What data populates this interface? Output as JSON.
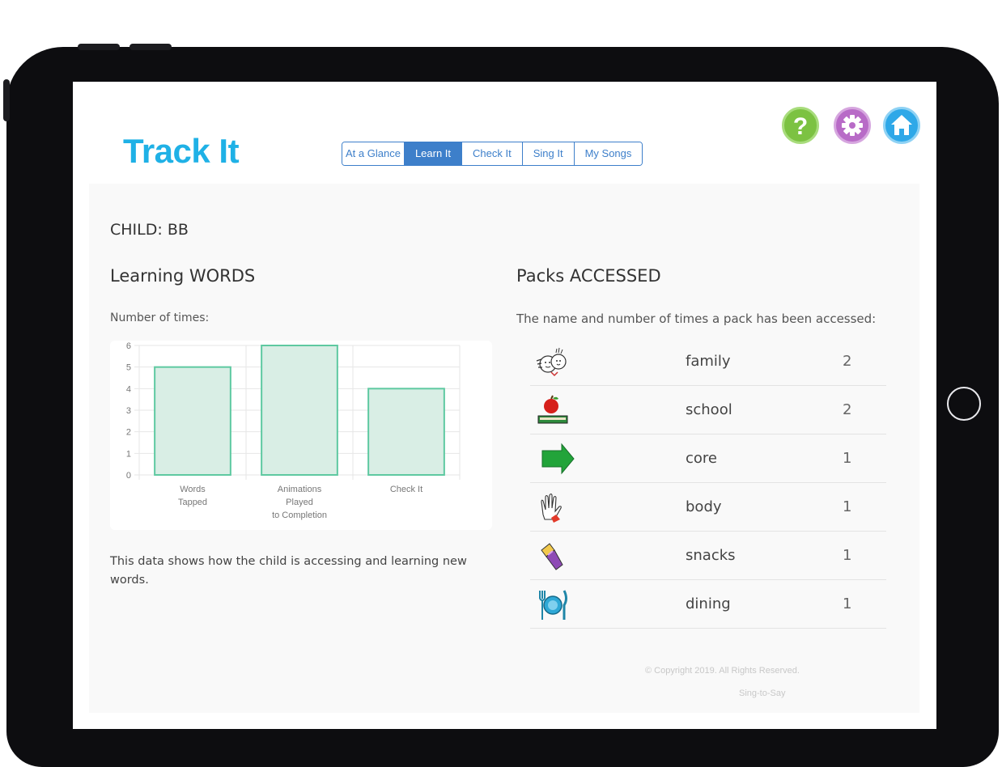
{
  "app": {
    "title": "Track It"
  },
  "tabs": [
    {
      "label": "At a Glance",
      "active": false
    },
    {
      "label": "Learn It",
      "active": true
    },
    {
      "label": "Check It",
      "active": false
    },
    {
      "label": "Sing It",
      "active": false
    },
    {
      "label": "My Songs",
      "active": false
    }
  ],
  "header_icons": [
    {
      "name": "help-icon",
      "color": "#7cc242"
    },
    {
      "name": "settings-icon",
      "color": "#b86bc7"
    },
    {
      "name": "home-icon",
      "color": "#2ea8e8"
    }
  ],
  "child": {
    "label": "CHILD: ",
    "name": "BB"
  },
  "learning": {
    "title_light": "Learning ",
    "title_bold": "WORDS",
    "subtitle": "Number of times:",
    "description": "This data shows how the child is accessing and learning new words."
  },
  "chart_data": {
    "type": "bar",
    "categories": [
      [
        "Words",
        "Tapped"
      ],
      [
        "Animations",
        "Played",
        "to Completion"
      ],
      [
        "Check It"
      ]
    ],
    "values": [
      5,
      6,
      4
    ],
    "ylim": [
      0,
      6
    ],
    "yticks": [
      0,
      1,
      2,
      3,
      4,
      5,
      6
    ],
    "grid": true,
    "bar_fill": "#d9eee5",
    "bar_stroke": "#5ec9a1"
  },
  "packs": {
    "title_light": "Packs ",
    "title_bold": "ACCESSED",
    "subtitle": "The name and number of times a pack has been accessed:",
    "items": [
      {
        "icon": "family-icon",
        "name": "family",
        "count": "2"
      },
      {
        "icon": "school-icon",
        "name": "school",
        "count": "2"
      },
      {
        "icon": "core-arrow-icon",
        "name": "core",
        "count": "1"
      },
      {
        "icon": "body-hand-icon",
        "name": "body",
        "count": "1"
      },
      {
        "icon": "snacks-icon",
        "name": "snacks",
        "count": "1"
      },
      {
        "icon": "dining-icon",
        "name": "dining",
        "count": "1"
      }
    ]
  },
  "footer": {
    "copyright": "© Copyright 2019. All Rights Reserved.",
    "brand": "Sing-to-Say"
  }
}
